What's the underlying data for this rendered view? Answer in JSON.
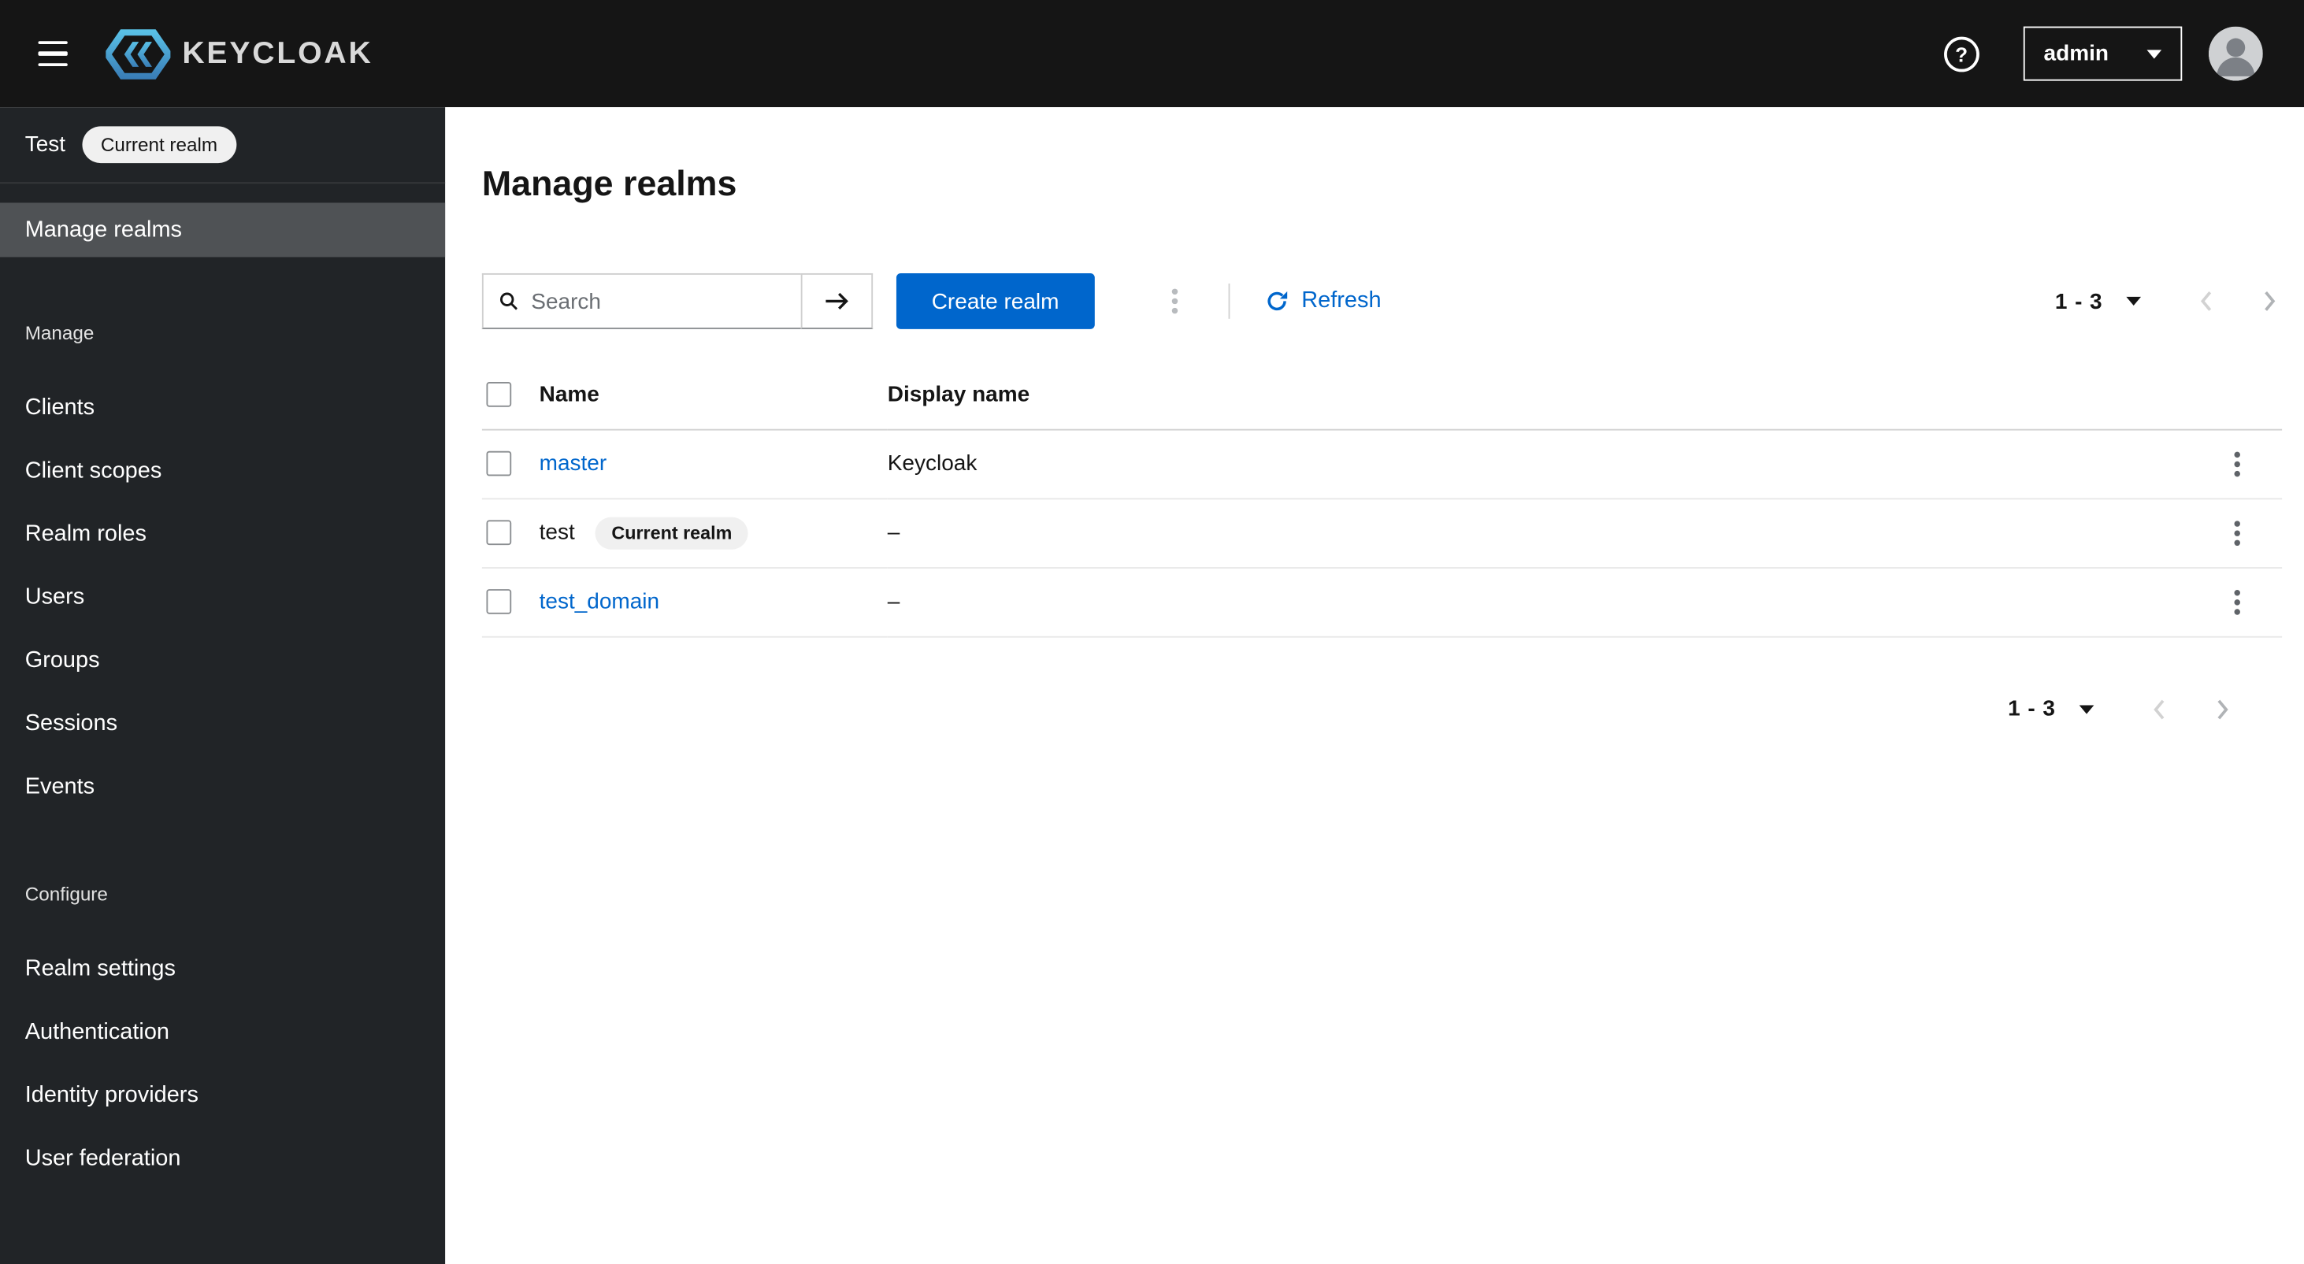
{
  "masthead": {
    "brand": "KEYCLOAK",
    "help_icon": "?",
    "username": "admin"
  },
  "sidebar": {
    "realm_name": "Test",
    "realm_badge": "Current realm",
    "manage_realms_item": "Manage realms",
    "sections": [
      {
        "title": "Manage",
        "items": [
          "Clients",
          "Client scopes",
          "Realm roles",
          "Users",
          "Groups",
          "Sessions",
          "Events"
        ]
      },
      {
        "title": "Configure",
        "items": [
          "Realm settings",
          "Authentication",
          "Identity providers",
          "User federation"
        ]
      }
    ]
  },
  "main": {
    "title": "Manage realms",
    "toolbar": {
      "search_placeholder": "Search",
      "create_button": "Create realm",
      "refresh_label": "Refresh"
    },
    "pagination_top": {
      "range": "1 - 3"
    },
    "pagination_bottom": {
      "range": "1 - 3"
    },
    "table": {
      "headers": {
        "name": "Name",
        "display_name": "Display name"
      },
      "rows": [
        {
          "name": "master",
          "display_name": "Keycloak"
        },
        {
          "name": "test",
          "badge": "Current realm",
          "display_name": "–"
        },
        {
          "name": "test_domain",
          "display_name": "–"
        }
      ]
    }
  },
  "colors": {
    "primary": "#0066cc",
    "link": "#0066cc",
    "masthead_bg": "#151515",
    "sidebar_bg": "#212427",
    "sidebar_selected_bg": "#4f5255"
  }
}
